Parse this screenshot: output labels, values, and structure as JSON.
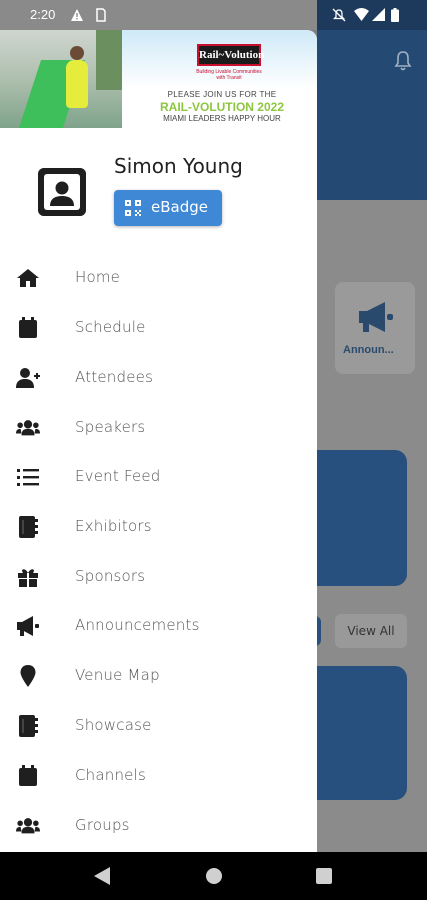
{
  "status_bar": {
    "time": "2:20",
    "left_icons": [
      "alert-icon",
      "sim-icon"
    ],
    "right_icons": [
      "mute-icon",
      "wifi-icon",
      "signal-icon",
      "battery-icon"
    ]
  },
  "banner": {
    "logo_text": "Rail~Volution",
    "tagline": "Building Livable Communities with Transit",
    "line1": "PLEASE JOIN US FOR THE",
    "line2": "RAIL-VOLUTION 2022",
    "line3": "MIAMI LEADERS HAPPY HOUR"
  },
  "profile": {
    "name": "Simon Young",
    "badge_button": "eBadge"
  },
  "menu": {
    "items": [
      {
        "label": "Home",
        "icon": "home-icon"
      },
      {
        "label": "Schedule",
        "icon": "calendar-icon"
      },
      {
        "label": "Attendees",
        "icon": "user-plus-icon"
      },
      {
        "label": "Speakers",
        "icon": "users-icon"
      },
      {
        "label": "Event Feed",
        "icon": "list-icon"
      },
      {
        "label": "Exhibitors",
        "icon": "address-book-icon"
      },
      {
        "label": "Sponsors",
        "icon": "gift-icon"
      },
      {
        "label": "Announcements",
        "icon": "megaphone-icon"
      },
      {
        "label": "Venue Map",
        "icon": "map-pin-icon"
      },
      {
        "label": "Showcase",
        "icon": "book-icon"
      },
      {
        "label": "Channels",
        "icon": "calendar-icon"
      },
      {
        "label": "Groups",
        "icon": "users-icon"
      }
    ]
  },
  "background": {
    "announcement_card_label": "Announ...",
    "view_all": "View All"
  },
  "colors": {
    "primary_blue": "#244a73",
    "badge_blue": "#3f88d6",
    "drawer_bg": "#ffffff"
  }
}
